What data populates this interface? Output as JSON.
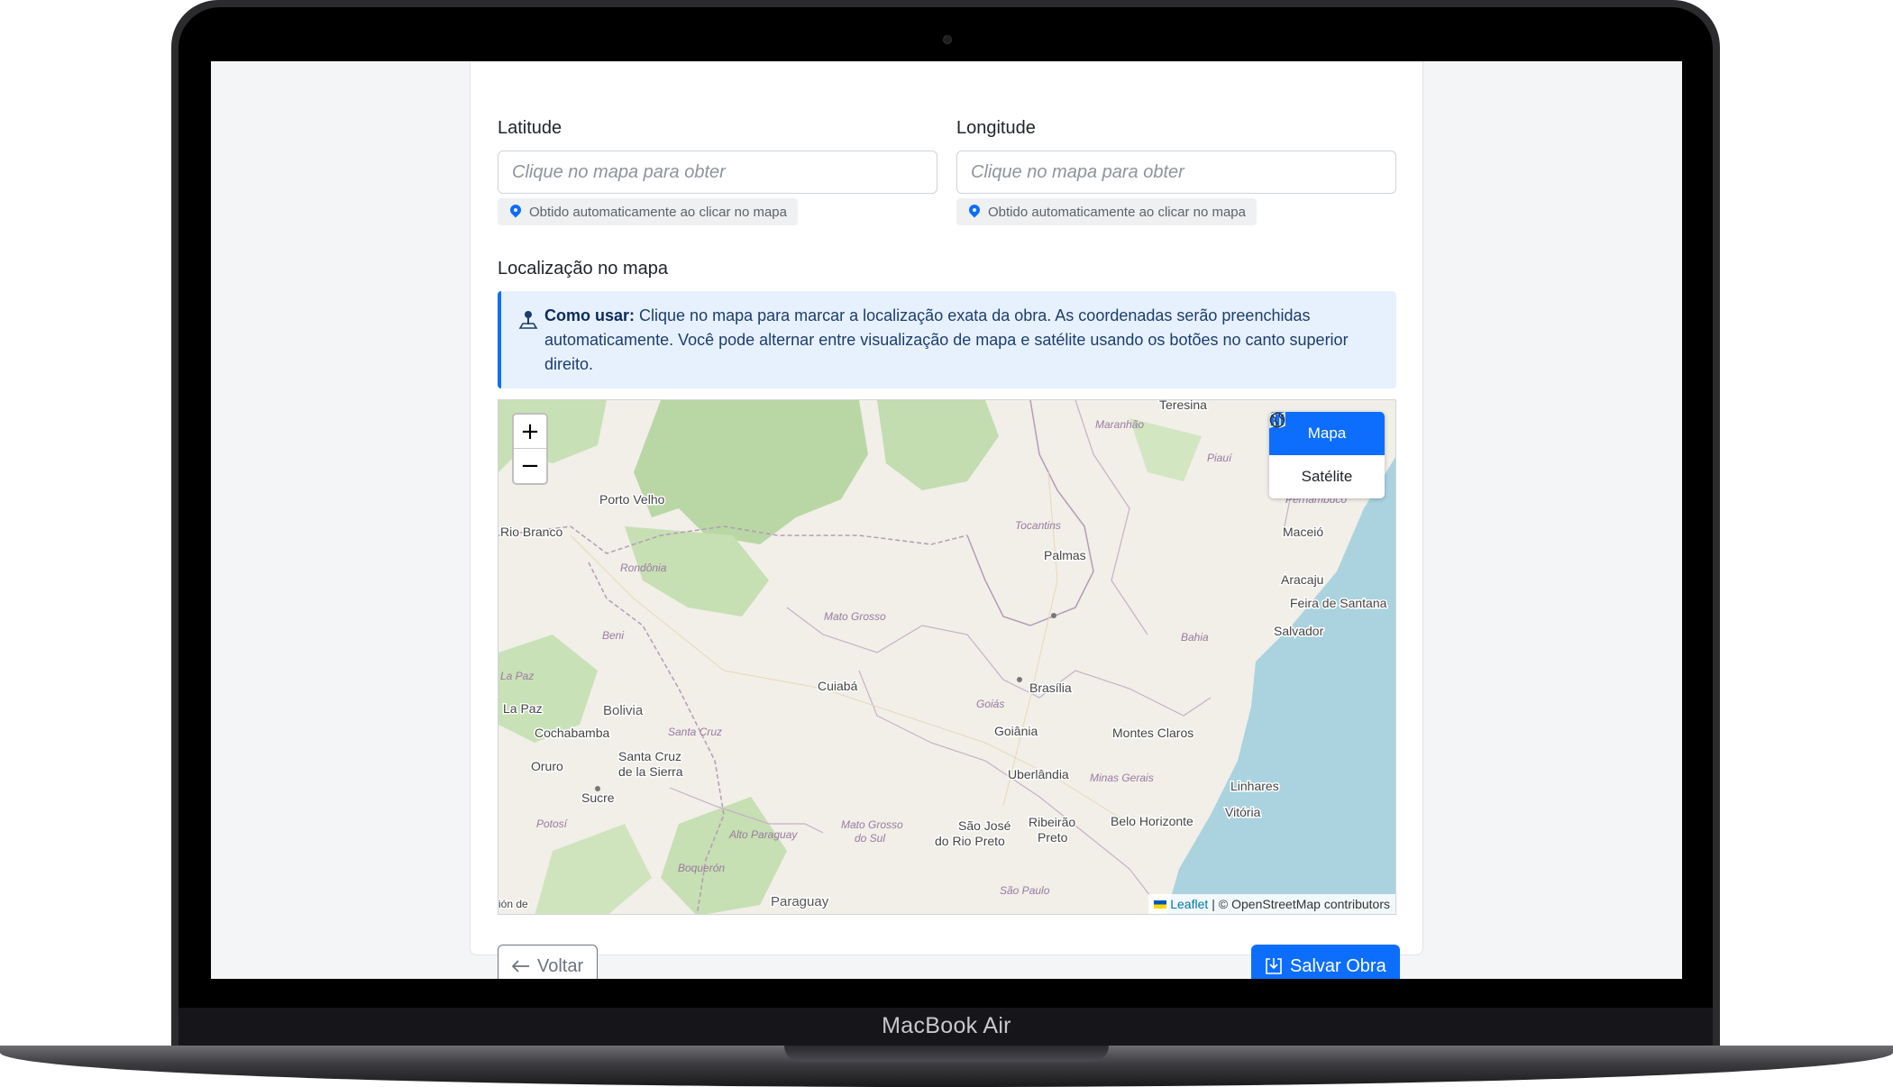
{
  "device": {
    "label": "MacBook Air"
  },
  "form": {
    "latitude": {
      "label": "Latitude",
      "placeholder": "Clique no mapa para obter",
      "hint": "Obtido automaticamente ao clicar no mapa"
    },
    "longitude": {
      "label": "Longitude",
      "placeholder": "Clique no mapa para obter",
      "hint": "Obtido automaticamente ao clicar no mapa"
    },
    "map_section_title": "Localização no mapa",
    "info": {
      "lead": "Como usar:",
      "text": "Clique no mapa para marcar a localização exata da obra. As coordenadas serão preenchidas automaticamente. Você pode alternar entre visualização de mapa e satélite usando os botões no canto superior direito."
    }
  },
  "map": {
    "zoom_in": "+",
    "zoom_out": "−",
    "layers": {
      "map_label": "Mapa",
      "satellite_label": "Satélite",
      "active": "map"
    },
    "attribution": {
      "leaflet": "Leaflet",
      "separator": "|",
      "osm": "© OpenStreetMap contributors"
    },
    "places": {
      "teresina": "Teresina",
      "maranhao": "Maranhão",
      "piaui": "Piauí",
      "pernambuco": "Pernambuco",
      "maceio": "Maceió",
      "porto_velho": "Porto Velho",
      "rio_branco": "Rio Branco",
      "tocantins": "Tocantins",
      "palmas": "Palmas",
      "rondonia": "Rondônia",
      "aracaju": "Aracaju",
      "feira_de_santana": "Feira de Santana",
      "mato_grosso": "Mato Grosso",
      "beni": "Beni",
      "bahia": "Bahia",
      "salvador": "Salvador",
      "la_paz_region": "La Paz",
      "cuiaba": "Cuiabá",
      "brasilia": "Brasília",
      "bolivia": "Bolivia",
      "la_paz": "La Paz",
      "goias": "Goiás",
      "cochabamba": "Cochabamba",
      "santa_cruz_region": "Santa Cruz",
      "goiania": "Goiânia",
      "montes_claros": "Montes Claros",
      "oruro": "Oruro",
      "santa_cruz": "Santa Cruz",
      "de_la_sierra": "de la Sierra",
      "uberlandia": "Uberlândia",
      "minas_gerais": "Minas Gerais",
      "sucre": "Sucre",
      "linhares": "Linhares",
      "vitoria": "Vitória",
      "potosi": "Potosí",
      "alto_paraguay": "Alto Paraguay",
      "mato_grosso_do_sul_1": "Mato Grosso",
      "mato_grosso_do_sul_2": "do Sul",
      "sao_jose": "São José",
      "do_rio_preto": "do Rio Preto",
      "ribeirao": "Ribeirão",
      "preto": "Preto",
      "belo_horizonte": "Belo Horizonte",
      "boqueron": "Boquerón",
      "sao_paulo": "São Paulo",
      "paraguay": "Paraguay",
      "cut_label": "ión de"
    }
  },
  "actions": {
    "back_label": "Voltar",
    "save_label": "Salvar Obra"
  },
  "colors": {
    "primary": "#0d6efd",
    "info_bg": "#e7f1fd",
    "map_land": "#f1efe8",
    "forest": "#b9d7a5",
    "water": "#aad3df"
  }
}
